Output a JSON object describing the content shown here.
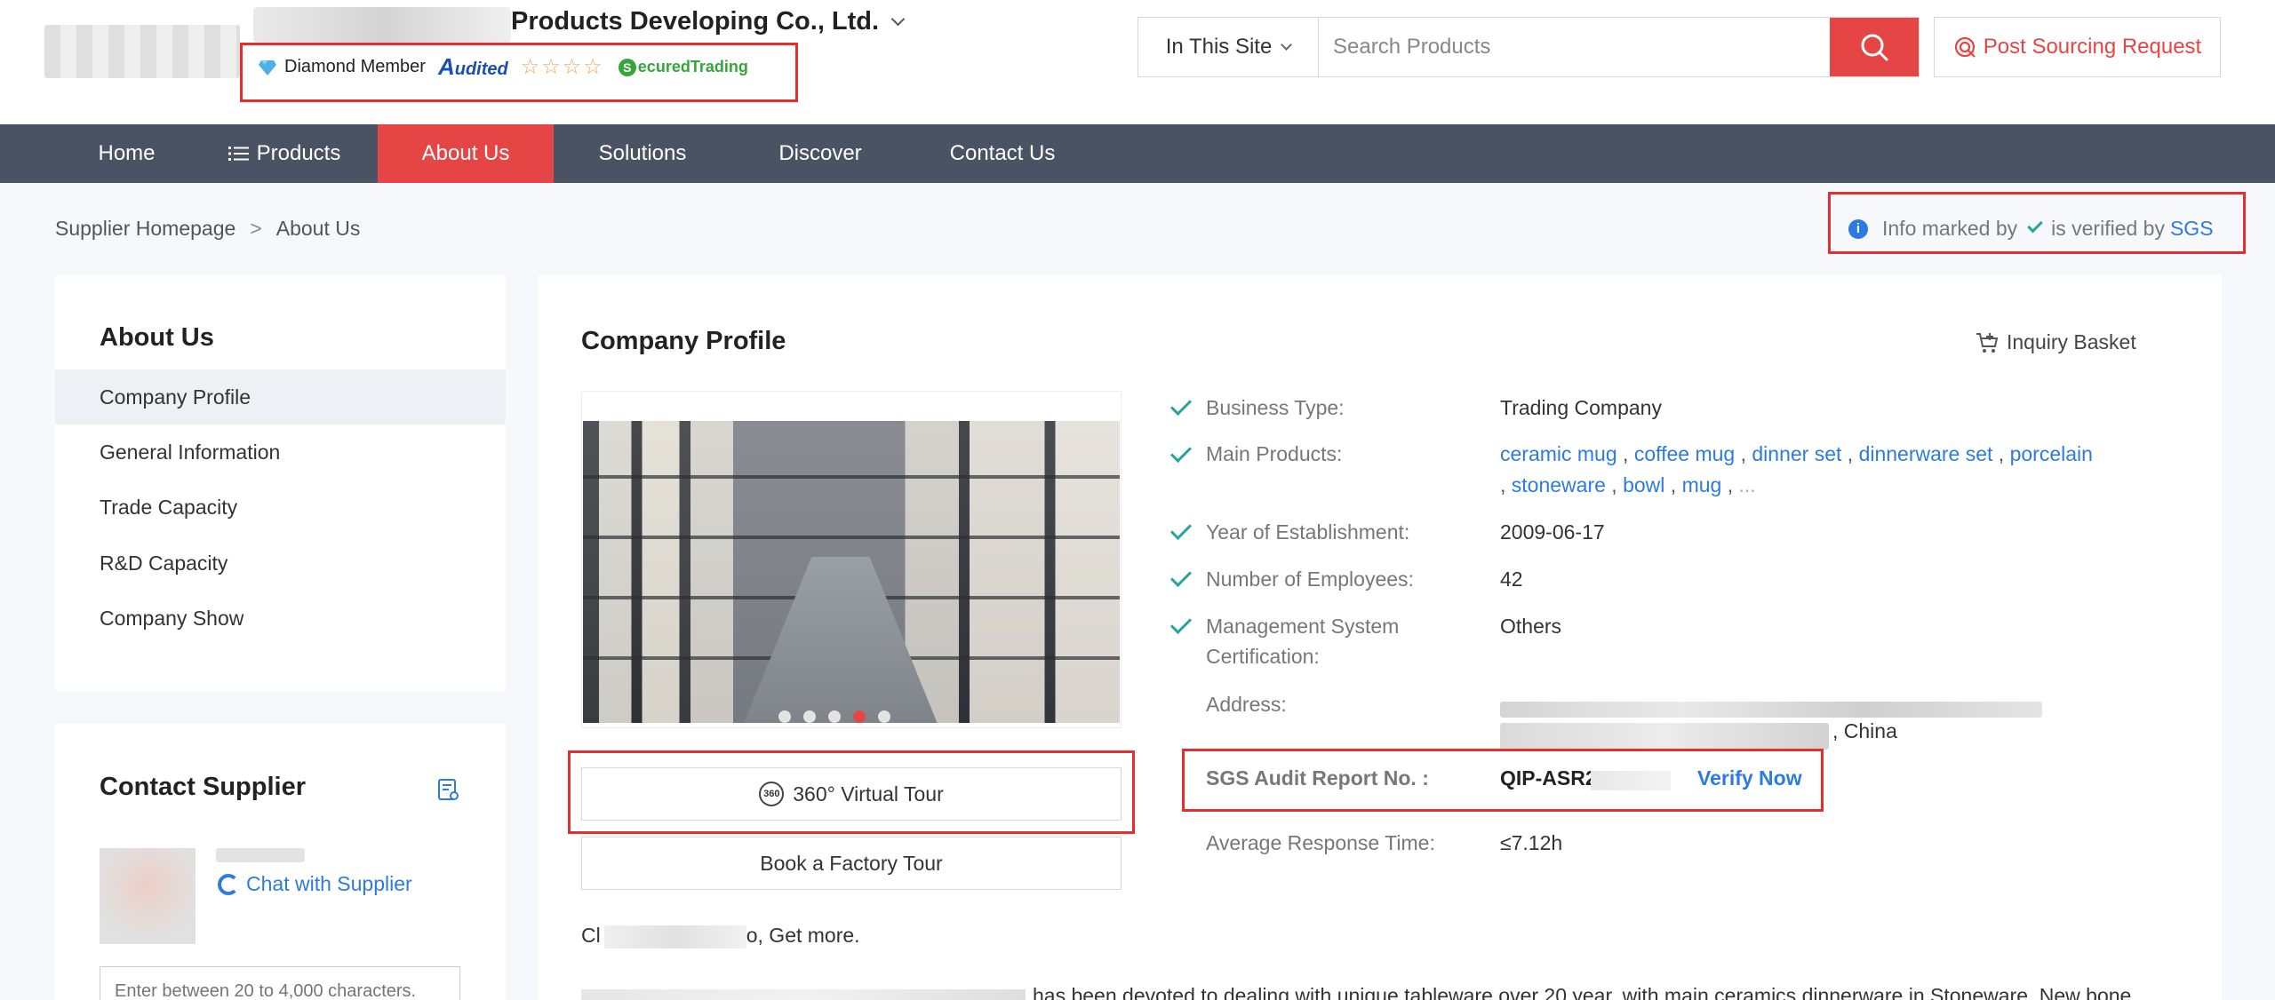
{
  "header": {
    "company_name_suffix": "Products Developing Co., Ltd.",
    "badges": {
      "diamond": "Diamond Member",
      "audited": "udited",
      "audited_initial": "A",
      "stars": "☆☆☆☆",
      "secured_initial": "S",
      "secured": "ecuredTrading"
    },
    "search": {
      "scope": "In This Site",
      "placeholder": "Search Products"
    },
    "post_request": "Post Sourcing Request"
  },
  "nav": {
    "items": [
      {
        "label": "Home"
      },
      {
        "label": "Products"
      },
      {
        "label": "About Us"
      },
      {
        "label": "Solutions"
      },
      {
        "label": "Discover"
      },
      {
        "label": "Contact Us"
      }
    ],
    "active": "About Us"
  },
  "breadcrumb": {
    "home": "Supplier Homepage",
    "separator": ">",
    "current": "About Us"
  },
  "verification_note": {
    "prefix": "Info marked by",
    "suffix": "is verified by",
    "brand": "SGS"
  },
  "sidebar": {
    "title": "About Us",
    "items": [
      {
        "label": "Company Profile"
      },
      {
        "label": "General Information"
      },
      {
        "label": "Trade Capacity"
      },
      {
        "label": "R&D Capacity"
      },
      {
        "label": "Company Show"
      }
    ]
  },
  "contact": {
    "title": "Contact Supplier",
    "chat": "Chat with Supplier",
    "message_placeholder": "Enter between 20 to 4,000 characters."
  },
  "main": {
    "title": "Company Profile",
    "basket": "Inquiry Basket",
    "virtual_tour": "360° Virtual Tour",
    "virtual_tour_icon_text": "360",
    "factory_tour": "Book a Factory Tour",
    "business_type_label": "Business Type:",
    "business_type_value": "Trading Company",
    "main_products_label": "Main Products:",
    "products": [
      "ceramic mug",
      "coffee mug",
      "dinner set",
      "dinnerware set",
      "porcelain",
      "stoneware",
      "bowl",
      "mug"
    ],
    "products_more": "...",
    "year_label": "Year of Establishment:",
    "year_value": "2009-06-17",
    "employees_label": "Number of Employees:",
    "employees_value": "42",
    "mgmt_label_1": "Management System",
    "mgmt_label_2": "Certification:",
    "mgmt_value": "Others",
    "address_label": "Address:",
    "address_tail": ", China",
    "sgs_label": "SGS Audit Report No. :",
    "sgs_value": "QIP-ASR2",
    "verify_now": "Verify Now",
    "response_label": "Average Response Time:",
    "response_value": "≤7.12h",
    "desc_line1_start": "Cl",
    "desc_line1_end": "o, Get more.",
    "desc_line2": "has been devoted to dealing with unique tableware over 20 year, with main ceramics dinnerware in Stoneware, New bone"
  },
  "colors": {
    "accent_red": "#e64545",
    "nav_bg": "#4a5364",
    "link_blue": "#2d7be0",
    "check_teal": "#27a59a",
    "highlight_red": "#e32f2f"
  }
}
